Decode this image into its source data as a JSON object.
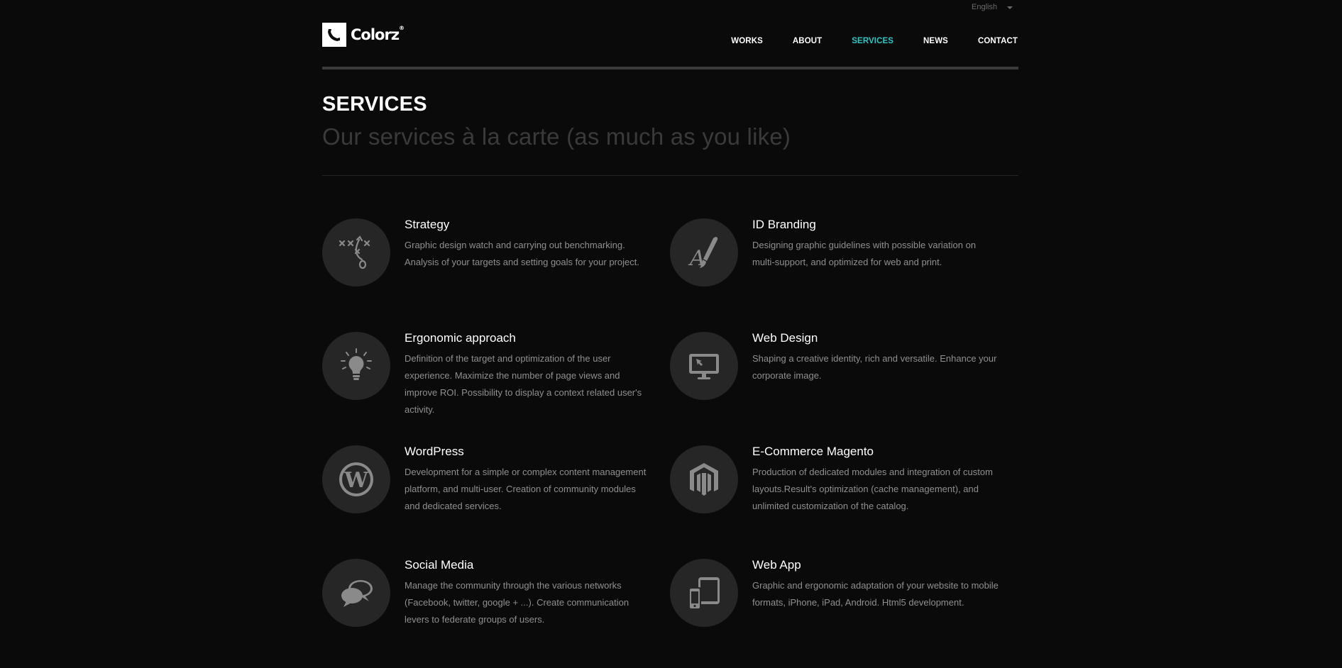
{
  "header": {
    "language": "English",
    "logo_text": "Colorz",
    "nav": [
      {
        "label": "WORKS",
        "active": false
      },
      {
        "label": "ABOUT",
        "active": false
      },
      {
        "label": "SERVICES",
        "active": true
      },
      {
        "label": "NEWS",
        "active": false
      },
      {
        "label": "CONTACT",
        "active": false
      }
    ]
  },
  "page": {
    "title": "SERVICES",
    "subtitle": "Our services à la carte (as much as you like)"
  },
  "services": [
    {
      "title": "Strategy",
      "description": "Graphic design watch and carrying out benchmarking. Analysis of your targets and setting goals for your project.",
      "icon": "strategy-icon"
    },
    {
      "title": "ID Branding",
      "description": "Designing graphic guidelines with possible variation on multi-support, and optimized for web and print.",
      "icon": "brush-icon"
    },
    {
      "title": "Ergonomic approach",
      "description": "Definition of the target and optimization of the user experience. Maximize the number of page views and improve ROI. Possibility to display a context related user's activity.",
      "icon": "lightbulb-icon"
    },
    {
      "title": "Web Design",
      "description": "Shaping a creative identity, rich and versatile. Enhance your corporate image.",
      "icon": "monitor-icon"
    },
    {
      "title": "WordPress",
      "description": "Development for a simple or complex content management platform, and multi-user. Creation of community modules and dedicated services.",
      "icon": "wordpress-icon"
    },
    {
      "title": "E-Commerce Magento",
      "description": "Production of dedicated modules and integration of custom layouts.Result's optimization (cache management), and unlimited customization of the catalog.",
      "icon": "magento-icon"
    },
    {
      "title": "Social Media",
      "description": "Manage the community through the various networks (Facebook, twitter, google + ...). Create communication levers to federate groups of users.",
      "icon": "speech-bubbles-icon"
    },
    {
      "title": "Web App",
      "description": "Graphic and ergonomic adaptation of your website to mobile formats, iPhone, iPad, Android. Html5 development.",
      "icon": "devices-icon"
    }
  ],
  "colors": {
    "background": "#0a0a0a",
    "accent": "#29c8c8",
    "icon_circle": "#262626",
    "icon_glyph": "#8a8a8a",
    "body_text": "#8f8f8f"
  }
}
